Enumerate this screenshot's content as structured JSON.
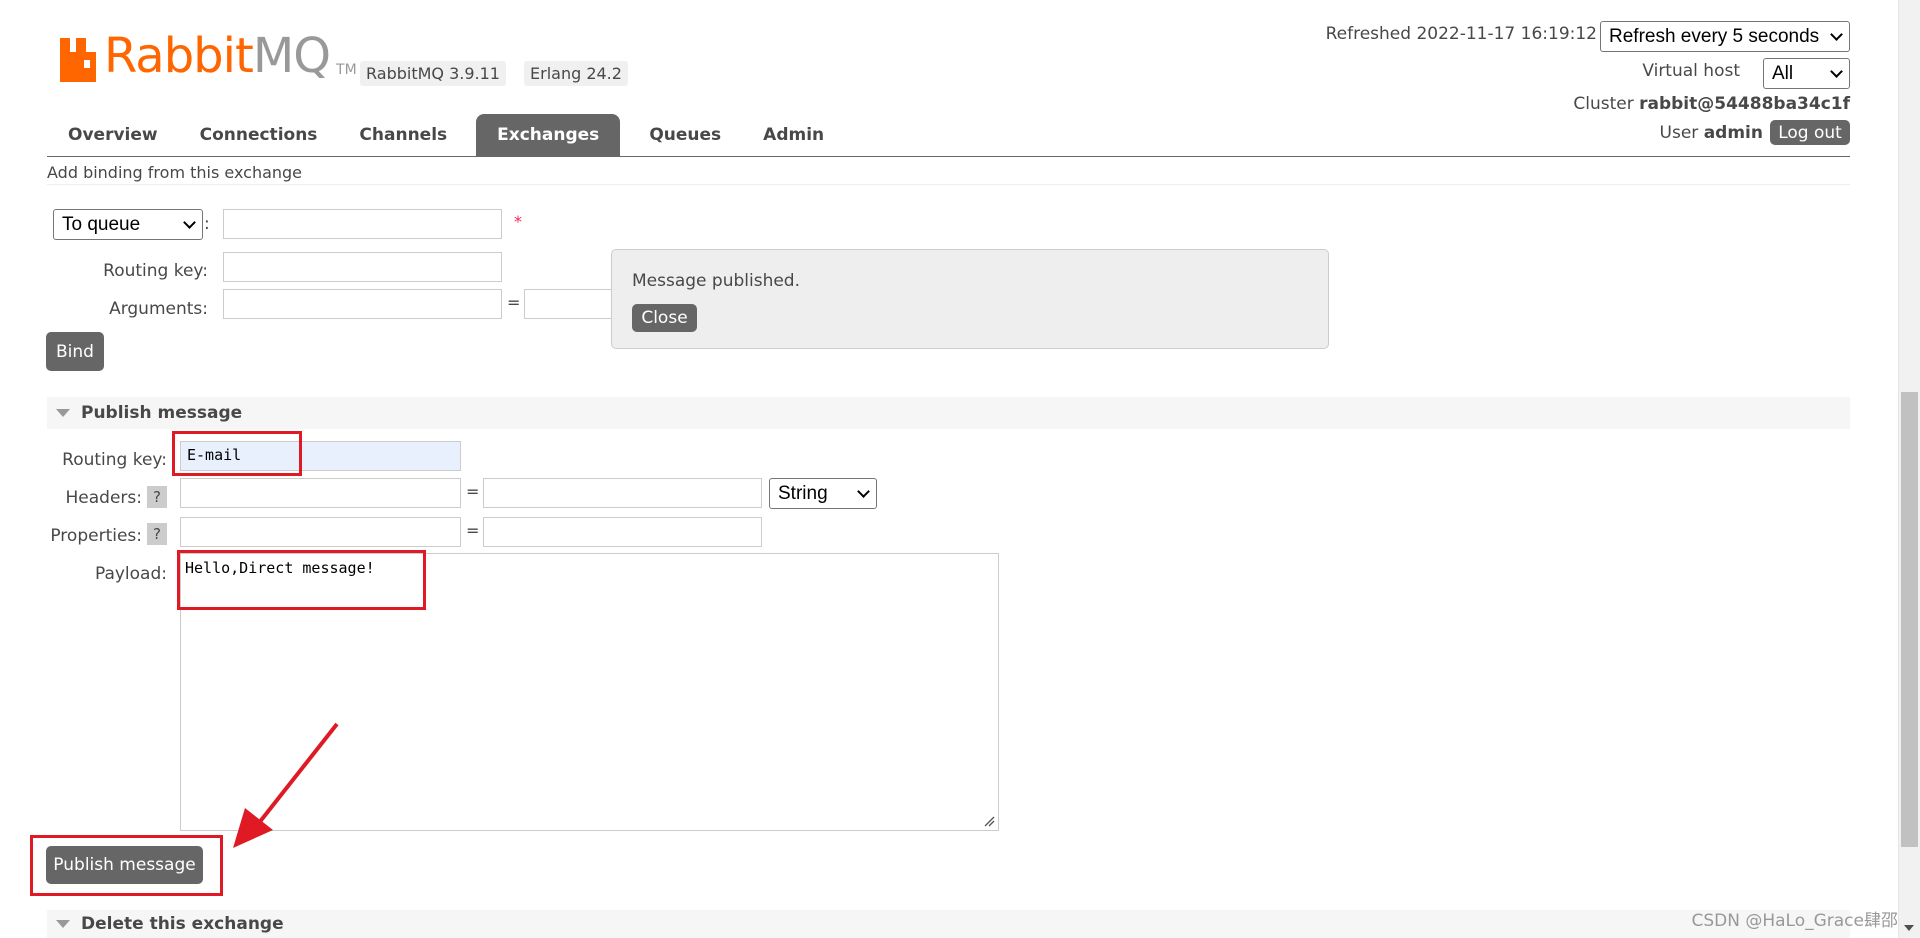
{
  "header": {
    "logo_rabbit": "Rabbit",
    "logo_mq": "MQ",
    "logo_tm": "TM",
    "version_badge": "RabbitMQ 3.9.11",
    "erlang_badge": "Erlang 24.2",
    "refreshed": "Refreshed 2022-11-17 16:19:12",
    "refresh_select": "Refresh every 5 seconds",
    "virtual_host_label": "Virtual host",
    "virtual_host_value": "All",
    "cluster_label": "Cluster",
    "cluster_name": "rabbit@54488ba34c1f",
    "user_label": "User",
    "user_name": "admin",
    "logout": "Log out"
  },
  "tabs": [
    "Overview",
    "Connections",
    "Channels",
    "Exchanges",
    "Queues",
    "Admin"
  ],
  "active_tab": "Exchanges",
  "binding": {
    "title": "Add binding from this exchange",
    "destination_type": "To queue",
    "colon": ":",
    "required_mark": "*",
    "routing_key_label": "Routing key:",
    "arguments_label": "Arguments:",
    "equals": "=",
    "bind_button": "Bind"
  },
  "toast": {
    "message": "Message published.",
    "close": "Close"
  },
  "publish": {
    "title": "Publish message",
    "routing_key_label": "Routing key:",
    "routing_key_value": "E-mail",
    "headers_label": "Headers:",
    "properties_label": "Properties:",
    "help": "?",
    "equals": "=",
    "header_type": "String",
    "payload_label": "Payload:",
    "payload_value": "Hello,Direct message!",
    "publish_button": "Publish message"
  },
  "delete_section": {
    "title": "Delete this exchange"
  },
  "watermark": "CSDN @HaLo_Grace肆邵",
  "colors": {
    "brand_orange": "#ff6600",
    "tab_active": "#666666",
    "annotation_red": "#e01a25"
  }
}
